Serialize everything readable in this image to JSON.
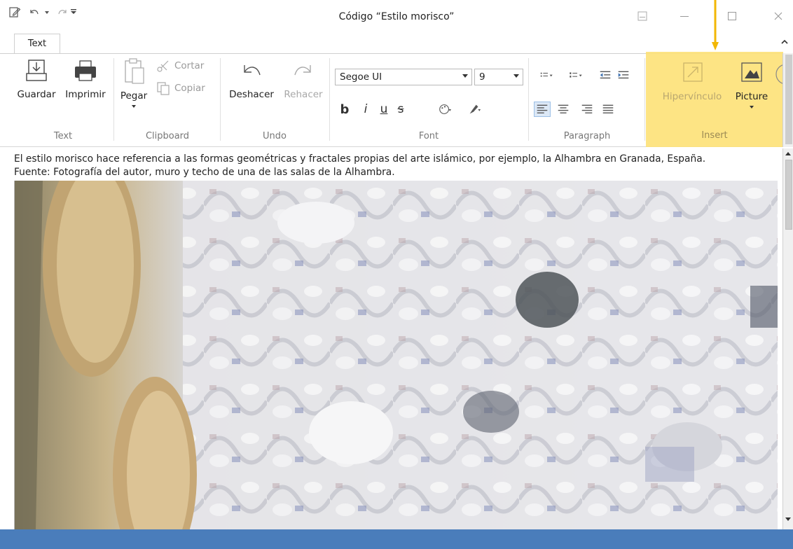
{
  "window": {
    "title": "Código “Estilo morisco”"
  },
  "tabs": {
    "text_tab": "Text"
  },
  "ribbon": {
    "text_group": {
      "label": "Text",
      "save": "Guardar",
      "print": "Imprimir"
    },
    "clipboard_group": {
      "label": "Clipboard",
      "paste": "Pegar",
      "cut": "Cortar",
      "copy": "Copiar"
    },
    "undo_group": {
      "label": "Undo",
      "undo": "Deshacer",
      "redo": "Rehacer"
    },
    "font_group": {
      "label": "Font",
      "font_name": "Segoe UI",
      "font_size": "9",
      "bold": "b",
      "italic": "i",
      "underline": "u",
      "strike": "s"
    },
    "paragraph_group": {
      "label": "Paragraph"
    },
    "insert_group": {
      "label": "Insert",
      "hyperlink": "Hipervínculo",
      "picture": "Picture"
    }
  },
  "document": {
    "caption_line1": "El estilo morisco hace referencia a las formas geométricas y fractales propias del arte islámico, por ejemplo, la Alhambra en Granada, España.",
    "caption_line2": "Fuente: Fotografía del autor, muro y techo de una de las salas de la Alhambra."
  },
  "colors": {
    "highlight": "#fde27a",
    "arrow": "#f2b705",
    "statusbar": "#4a7dbb"
  }
}
